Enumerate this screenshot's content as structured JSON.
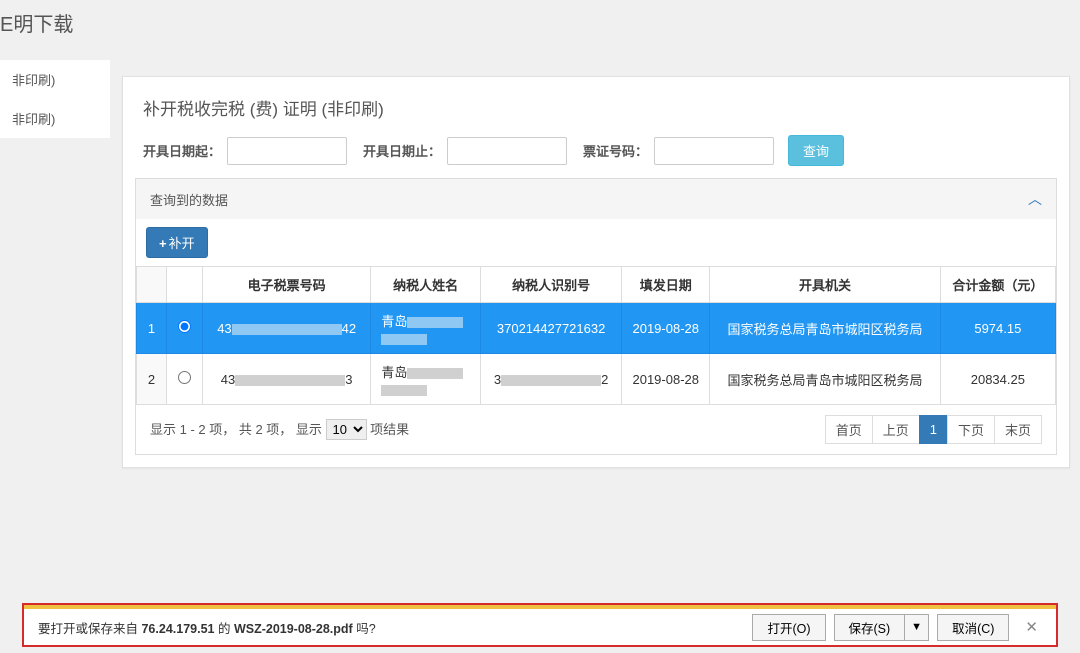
{
  "page_title_suffix": "E明下载",
  "sidebar": {
    "items": [
      {
        "label": "非印刷)"
      },
      {
        "label": "非印刷)"
      }
    ]
  },
  "panel": {
    "title": "补开税收完税 (费) 证明 (非印刷)",
    "search": {
      "date_from_label": "开具日期起：",
      "date_to_label": "开具日期止：",
      "ticket_no_label": "票证号码：",
      "query_btn": "查询"
    },
    "data_header": "查询到的数据",
    "add_btn": "补开",
    "columns": [
      "",
      "",
      "电子税票号码",
      "纳税人姓名",
      "纳税人识别号",
      "填发日期",
      "开具机关",
      "合计金额（元）"
    ],
    "rows": [
      {
        "index": "1",
        "selected": true,
        "ticket_prefix": "43",
        "ticket_suffix": "42",
        "name_prefix": "青岛",
        "tax_id": "370214427721632",
        "date": "2019-08-28",
        "org": "国家税务总局青岛市城阳区税务局",
        "amount": "5974.15"
      },
      {
        "index": "2",
        "selected": false,
        "ticket_prefix": "43",
        "ticket_suffix": "3",
        "name_prefix": "青岛",
        "tax_id_prefix": "3",
        "tax_id_suffix": "2",
        "date": "2019-08-28",
        "org": "国家税务总局青岛市城阳区税务局",
        "amount": "20834.25"
      }
    ],
    "pagination": {
      "text_pre": "显示 1 - 2 项， 共 2 项， 显示 ",
      "page_size": "10",
      "text_post": " 项结果",
      "first": "首页",
      "prev": "上页",
      "current": "1",
      "next": "下页",
      "last": "末页"
    }
  },
  "download": {
    "prompt_pre": "要打开或保存来自 ",
    "host": "76.24.179.51",
    "prompt_mid": " 的 ",
    "file": "WSZ-2019-08-28.pdf",
    "prompt_post": " 吗?",
    "open": "打开(O)",
    "save": "保存(S)",
    "cancel": "取消(C)"
  }
}
